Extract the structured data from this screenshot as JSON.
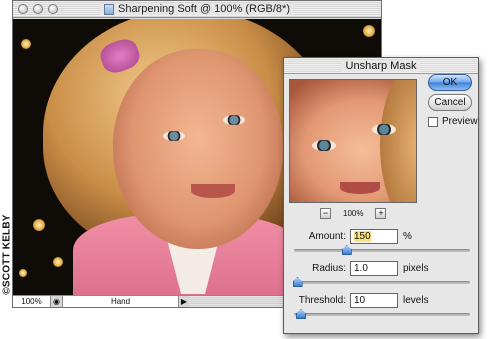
{
  "credit": "©SCOTT KELBY",
  "document": {
    "title": "Sharpening Soft @ 100% (RGB/8*)",
    "status": {
      "zoom": "100%",
      "tool": "Hand"
    }
  },
  "dialog": {
    "title": "Unsharp Mask",
    "preview_zoom": "100%",
    "ok_label": "OK",
    "cancel_label": "Cancel",
    "preview_label": "Preview",
    "preview_checked": false,
    "amount": {
      "label": "Amount:",
      "value": "150",
      "unit": "%",
      "slider_fraction": 0.3
    },
    "radius": {
      "label": "Radius:",
      "value": "1.0",
      "unit": "pixels",
      "slider_fraction": 0.02
    },
    "threshold": {
      "label": "Threshold:",
      "value": "10",
      "unit": "levels",
      "slider_fraction": 0.04
    }
  },
  "colors": {
    "ok_button": "#3f80d8",
    "amount_highlight": "#fbe27a"
  },
  "icons": [
    "close-icon",
    "minimize-icon",
    "zoom-icon",
    "document-icon",
    "zoom-out-icon",
    "zoom-in-icon",
    "status-menu-arrow-icon"
  ]
}
